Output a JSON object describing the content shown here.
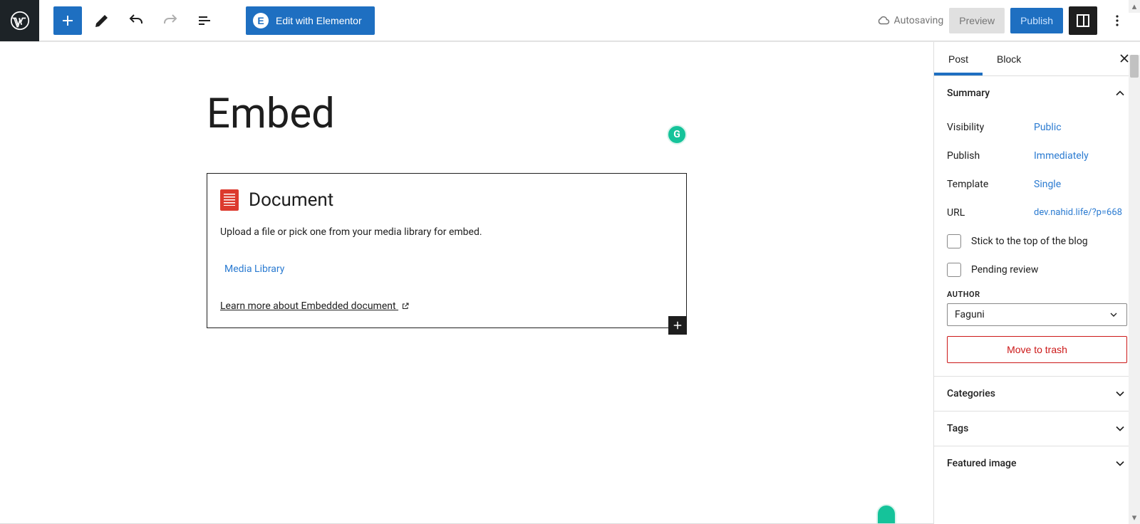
{
  "topbar": {
    "elementor_label": "Edit with Elementor",
    "autosave_label": "Autosaving",
    "preview_label": "Preview",
    "publish_label": "Publish"
  },
  "post": {
    "title": "Embed",
    "block_title": "Document",
    "block_desc": "Upload a file or pick one from your media library for embed.",
    "media_library_label": "Media Library",
    "learn_more_label": "Learn more about Embedded document "
  },
  "sidebar": {
    "tabs": {
      "post": "Post",
      "block": "Block"
    },
    "summary": {
      "title": "Summary",
      "visibility_label": "Visibility",
      "visibility_value": "Public",
      "publish_label": "Publish",
      "publish_value": "Immediately",
      "template_label": "Template",
      "template_value": "Single",
      "url_label": "URL",
      "url_value": "dev.nahid.life/?p=668",
      "stick_label": "Stick to the top of the blog",
      "pending_label": "Pending review",
      "author_label": "AUTHOR",
      "author_value": "Faguni",
      "trash_label": "Move to trash"
    },
    "panels": {
      "categories": "Categories",
      "tags": "Tags",
      "featured_image": "Featured image"
    }
  }
}
